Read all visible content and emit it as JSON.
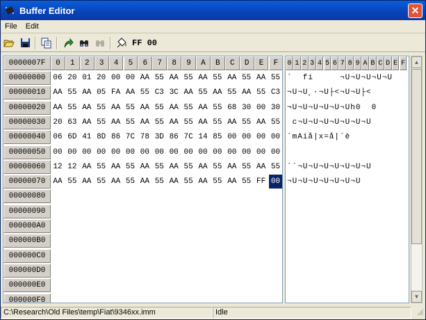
{
  "window": {
    "title": "Buffer Editor",
    "close_label": "✕"
  },
  "menu": {
    "items": [
      "File",
      "Edit"
    ]
  },
  "toolbar": {
    "fill_value": "FF 00"
  },
  "hex": {
    "corner": "0000007F",
    "columns": [
      "0",
      "1",
      "2",
      "3",
      "4",
      "5",
      "6",
      "7",
      "8",
      "9",
      "A",
      "B",
      "C",
      "D",
      "E",
      "F"
    ],
    "addresses": [
      "00000000",
      "00000010",
      "00000020",
      "00000030",
      "00000040",
      "00000050",
      "00000060",
      "00000070",
      "00000080",
      "00000090",
      "000000A0",
      "000000B0",
      "000000C0",
      "000000D0",
      "000000E0",
      "000000F0"
    ],
    "rows": [
      [
        "06",
        "20",
        "01",
        "20",
        "00",
        "00",
        "AA",
        "55",
        "AA",
        "55",
        "AA",
        "55",
        "AA",
        "55",
        "AA",
        "55"
      ],
      [
        "AA",
        "55",
        "AA",
        "05",
        "FA",
        "AA",
        "55",
        "C3",
        "3C",
        "AA",
        "55",
        "AA",
        "55",
        "AA",
        "55",
        "C3"
      ],
      [
        "AA",
        "55",
        "AA",
        "55",
        "AA",
        "55",
        "AA",
        "55",
        "AA",
        "55",
        "AA",
        "55",
        "68",
        "30",
        "00",
        "30"
      ],
      [
        "20",
        "63",
        "AA",
        "55",
        "AA",
        "55",
        "AA",
        "55",
        "AA",
        "55",
        "AA",
        "55",
        "AA",
        "55",
        "AA",
        "55"
      ],
      [
        "06",
        "6D",
        "41",
        "8D",
        "86",
        "7C",
        "78",
        "3D",
        "86",
        "7C",
        "14",
        "85",
        "00",
        "00",
        "00",
        "00"
      ],
      [
        "00",
        "00",
        "00",
        "00",
        "00",
        "00",
        "00",
        "00",
        "00",
        "00",
        "00",
        "00",
        "00",
        "00",
        "00",
        "00"
      ],
      [
        "12",
        "12",
        "AA",
        "55",
        "AA",
        "55",
        "AA",
        "55",
        "AA",
        "55",
        "AA",
        "55",
        "AA",
        "55",
        "AA",
        "55"
      ],
      [
        "AA",
        "55",
        "AA",
        "55",
        "AA",
        "55",
        "AA",
        "55",
        "AA",
        "55",
        "AA",
        "55",
        "AA",
        "55",
        "FF",
        "00"
      ],
      [],
      [],
      [],
      [],
      [],
      [],
      [],
      []
    ]
  },
  "ascii": {
    "columns": [
      "0",
      "1",
      "2",
      "3",
      "4",
      "5",
      "6",
      "7",
      "8",
      "9",
      "A",
      "B",
      "C",
      "D",
      "E",
      "F"
    ],
    "lines": [
      "´  fi     ¬U¬U¬U¬U¬U",
      "¬U¬U¸·¬U├<¬U¬U├<",
      "¬U¬U¬U¬U¬U¬Uh0  0",
      " c¬U¬U¬U¬U¬U¬U¬U",
      "´mAiå|x=å|´è",
      "",
      "´´¬U¬U¬U¬U¬U¬U¬U",
      "¬U¬U¬U¬U¬U¬U¬U",
      "",
      "",
      "",
      "",
      "",
      "",
      "",
      ""
    ]
  },
  "status": {
    "path": "C:\\Research\\Old Files\\temp\\Fiat\\9346xx.imm",
    "state": "Idle"
  }
}
